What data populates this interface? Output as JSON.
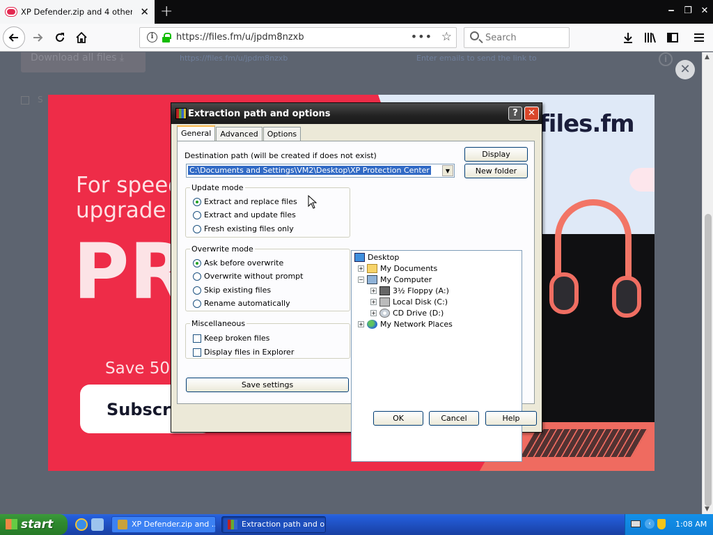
{
  "browser": {
    "tab_title": "XP Defender.zip and 4 other files",
    "new_tab": "+",
    "url": "https://files.fm/u/jpdm8nzxb",
    "search_placeholder": "Search",
    "min": "‒",
    "restore": "❐",
    "close": "✕"
  },
  "page": {
    "download_all": "Download all files  ⤓",
    "link_text": "https://files.fm/u/jpdm8nzxb",
    "email_placeholder": "Enter emails to send the link to",
    "s_label": "S",
    "overlay_close": "✕"
  },
  "ad": {
    "logo": "files.fm",
    "headline_1": "For speed",
    "headline_2": "upgrade",
    "pro": "PR",
    "save": "Save 50",
    "subscribe": "Subscri"
  },
  "dialog": {
    "title": "Extraction path and options",
    "help": "?",
    "close": "✕",
    "tabs": [
      "General",
      "Advanced",
      "Options"
    ],
    "dest_label": "Destination path (will be created if does not exist)",
    "dest_value": "C:\\Documents and Settings\\VM2\\Desktop\\XP Protection Center",
    "display_button": "Display",
    "new_folder_button": "New folder",
    "update_mode": {
      "title": "Update mode",
      "options": [
        "Extract and replace files",
        "Extract and update files",
        "Fresh existing files only"
      ],
      "selected": 0
    },
    "overwrite_mode": {
      "title": "Overwrite mode",
      "options": [
        "Ask before overwrite",
        "Overwrite without prompt",
        "Skip existing files",
        "Rename automatically"
      ],
      "selected": 0
    },
    "misc": {
      "title": "Miscellaneous",
      "options": [
        "Keep broken files",
        "Display files in Explorer"
      ]
    },
    "save_settings": "Save settings",
    "tree": {
      "desktop": "Desktop",
      "my_documents": "My Documents",
      "my_computer": "My Computer",
      "floppy": "3½ Floppy (A:)",
      "local_disk": "Local Disk (C:)",
      "cd_drive": "CD Drive (D:)",
      "network": "My Network Places"
    },
    "ok": "OK",
    "cancel": "Cancel",
    "help_button": "Help"
  },
  "taskbar": {
    "start": "start",
    "task_1": "XP Defender.zip and ...",
    "task_2": "Extraction path and o...",
    "clock": "1:08 AM"
  }
}
